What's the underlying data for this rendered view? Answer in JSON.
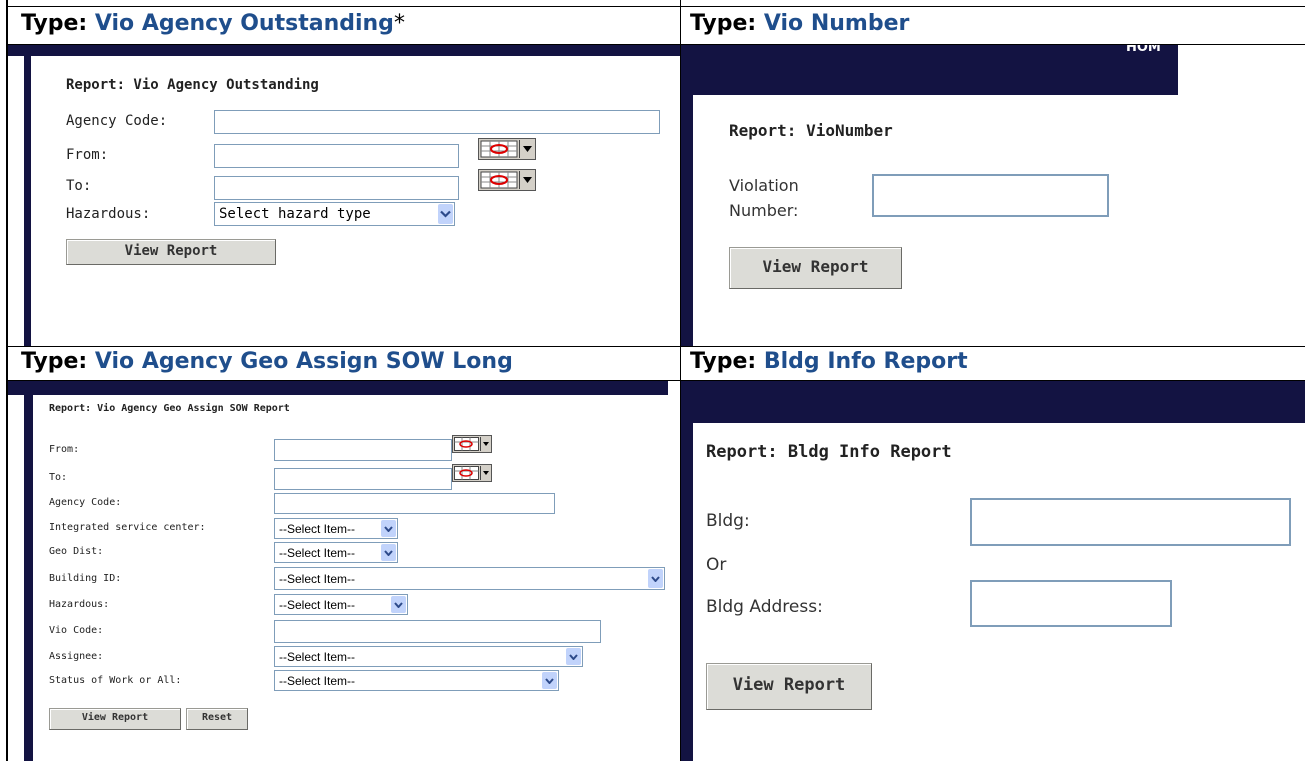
{
  "headers": {
    "q1": {
      "prefix": "Type: ",
      "name": "Vio Agency Outstanding",
      "suffix": "*"
    },
    "q2": {
      "prefix": "Type",
      "colon": ": ",
      "name": "Vio Number"
    },
    "q3": {
      "prefix": "Type: ",
      "name": "Vio Agency Geo Assign SOW Long"
    },
    "q4": {
      "prefix": "Type",
      "colon": ": ",
      "name": "Bldg Info Report"
    }
  },
  "panel1": {
    "title": "Report: Vio Agency Outstanding",
    "labels": {
      "agency_code": "Agency Code:",
      "from": "From:",
      "to": "To:",
      "hazardous": "Hazardous:"
    },
    "hazard_select": "Select hazard type",
    "view_button": "View Report"
  },
  "panel2": {
    "nav_text": "HOM",
    "title": "Report: VioNumber",
    "label_line1": "Violation",
    "label_line2": "Number:",
    "view_button": "View Report"
  },
  "panel3": {
    "title": "Report: Vio Agency Geo Assign SOW Report",
    "labels": {
      "from": "From:",
      "to": "To:",
      "agency_code": "Agency Code:",
      "isc": "Integrated service center:",
      "geo_dist": "Geo Dist:",
      "building_id": "Building ID:",
      "hazardous": "Hazardous:",
      "vio_code": "Vio Code:",
      "assignee": "Assignee:",
      "status": "Status of Work or All:"
    },
    "select_item": "--Select Item--",
    "view_button": "View Report",
    "reset_button": "Reset"
  },
  "panel4": {
    "title": "Report: Bldg Info Report",
    "labels": {
      "bldg": "Bldg:",
      "or": "Or",
      "bldg_address": "Bldg Address:"
    },
    "view_button": "View Report"
  },
  "colors": {
    "header_highlight": "#1f4e8c",
    "navbar": "#131342",
    "field_border": "#7f9db9"
  }
}
